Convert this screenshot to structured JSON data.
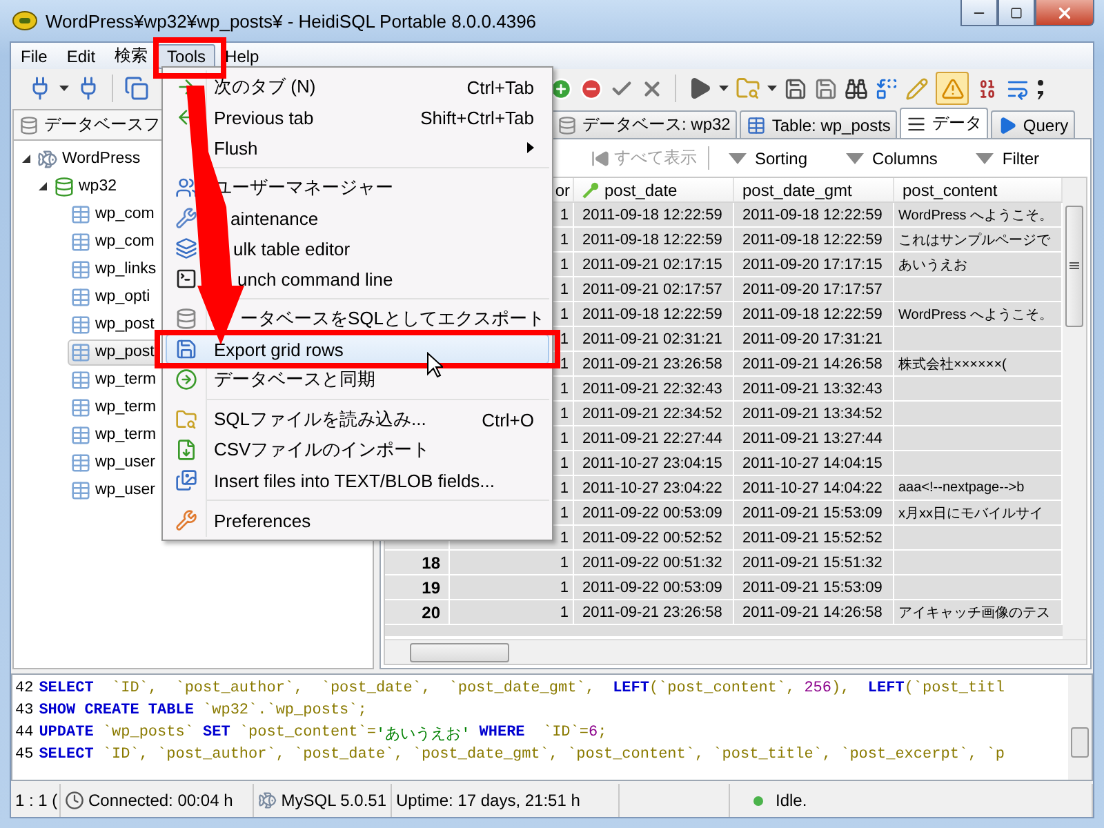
{
  "window": {
    "title": "WordPress¥wp32¥wp_posts¥ - HeidiSQL Portable 8.0.0.4396"
  },
  "menu_bar": [
    {
      "label": "File",
      "selected": false
    },
    {
      "label": "Edit",
      "selected": false
    },
    {
      "label": "検索",
      "selected": false
    },
    {
      "label": "Tools",
      "selected": true
    },
    {
      "label": "Help",
      "selected": false
    }
  ],
  "toolbar": {
    "toggle_button": {
      "on": true
    }
  },
  "tools_menu": [
    {
      "kind": "item",
      "label": "次のタブ (N)",
      "shortcut": "Ctrl+Tab",
      "selected": false
    },
    {
      "kind": "item",
      "label": "Previous tab",
      "shortcut": "Shift+Ctrl+Tab",
      "selected": false
    },
    {
      "kind": "submenu",
      "label": "Flush",
      "selected": false
    },
    {
      "kind": "separator"
    },
    {
      "kind": "item",
      "label": "ユーザーマネージャー",
      "selected": false
    },
    {
      "kind": "item",
      "label": "aintenance",
      "selected": false
    },
    {
      "kind": "item",
      "label": "ulk table editor",
      "selected": false
    },
    {
      "kind": "item",
      "label": "unch command line",
      "selected": false
    },
    {
      "kind": "separator"
    },
    {
      "kind": "item",
      "label": "ータベースをSQLとしてエクスポート",
      "selected": false
    },
    {
      "kind": "item",
      "label": "Export grid rows",
      "selected": true
    },
    {
      "kind": "item",
      "label": "データベースと同期",
      "selected": false
    },
    {
      "kind": "separator"
    },
    {
      "kind": "item",
      "label": "SQLファイルを読み込み...",
      "shortcut": "Ctrl+O",
      "selected": false
    },
    {
      "kind": "item",
      "label": "CSVファイルのインポート",
      "selected": false
    },
    {
      "kind": "item",
      "label": "Insert files into TEXT/BLOB fields...",
      "selected": false
    },
    {
      "kind": "separator"
    },
    {
      "kind": "item",
      "label": "Preferences",
      "selected": false
    }
  ],
  "left_panel": {
    "tab": "データベースフ",
    "tree": [
      {
        "label": "WordPress",
        "kind": "server",
        "expanded": true,
        "selected": false,
        "children": [
          {
            "label": "wp32",
            "kind": "database",
            "expanded": true,
            "selected": false,
            "children": [
              {
                "label": "wp_com",
                "kind": "table",
                "selected": false
              },
              {
                "label": "wp_com",
                "kind": "table",
                "selected": false
              },
              {
                "label": "wp_links",
                "kind": "table",
                "selected": false
              },
              {
                "label": "wp_opti",
                "kind": "table",
                "selected": false
              },
              {
                "label": "wp_post",
                "kind": "table",
                "selected": false
              },
              {
                "label": "wp_post",
                "kind": "table",
                "selected": true
              },
              {
                "label": "wp_term",
                "kind": "table",
                "selected": false
              },
              {
                "label": "wp_term",
                "kind": "table",
                "selected": false
              },
              {
                "label": "wp_term",
                "kind": "table",
                "selected": false
              },
              {
                "label": "wp_user",
                "kind": "table",
                "selected": false
              },
              {
                "label": "wp_user",
                "kind": "table",
                "selected": false
              }
            ]
          }
        ]
      }
    ]
  },
  "right_panel": {
    "tabs": [
      {
        "label": "データベース: wp32",
        "kind": "database",
        "selected": false
      },
      {
        "label": "Table: wp_posts",
        "kind": "table",
        "selected": false
      },
      {
        "label": "データ",
        "kind": "data",
        "selected": true
      },
      {
        "label": "Query",
        "kind": "query",
        "selected": false
      }
    ],
    "grid_toolbar": {
      "show_all": {
        "label": "すべて表示",
        "disabled": true
      },
      "dropdowns": [
        "Sorting",
        "Columns",
        "Filter"
      ]
    },
    "grid": {
      "columns": [
        "or",
        "post_date",
        "post_date_gmt",
        "post_content"
      ],
      "rows": [
        {
          "cells": [
            "1",
            "2011-09-18 12:22:59",
            "2011-09-18 12:22:59",
            "WordPress へようこそ。"
          ]
        },
        {
          "cells": [
            "1",
            "2011-09-18 12:22:59",
            "2011-09-18 12:22:59",
            "これはサンプルページで"
          ]
        },
        {
          "cells": [
            "1",
            "2011-09-21 02:17:15",
            "2011-09-20 17:17:15",
            "あいうえお"
          ]
        },
        {
          "cells": [
            "1",
            "2011-09-21 02:17:57",
            "2011-09-20 17:17:57"
          ]
        },
        {
          "cells": [
            "1",
            "2011-09-18 12:22:59",
            "2011-09-18 12:22:59",
            "WordPress へようこそ。"
          ]
        },
        {
          "cells": [
            "1",
            "2011-09-21 02:31:21",
            "2011-09-20 17:31:21"
          ]
        },
        {
          "cells": [
            "1",
            "2011-09-21 23:26:58",
            "2011-09-21 14:26:58",
            "株式会社××××××("
          ]
        },
        {
          "cells": [
            "1",
            "2011-09-21 22:32:43",
            "2011-09-21 13:32:43"
          ]
        },
        {
          "cells": [
            "1",
            "2011-09-21 22:34:52",
            "2011-09-21 13:34:52"
          ]
        },
        {
          "cells": [
            "1",
            "2011-09-21 22:27:44",
            "2011-09-21 13:27:44"
          ]
        },
        {
          "cells": [
            "1",
            "2011-10-27 23:04:15",
            "2011-10-27 14:04:15"
          ]
        },
        {
          "cells": [
            "1",
            "2011-10-27 23:04:22",
            "2011-10-27 14:04:22",
            "aaa<!--nextpage-->b"
          ]
        },
        {
          "cells": [
            "1",
            "2011-09-22 00:53:09",
            "2011-09-21 15:53:09",
            "x月xx日にモバイルサイ"
          ]
        },
        {
          "cells": [
            "1",
            "2011-09-22 00:52:52",
            "2011-09-21 15:52:52"
          ]
        },
        {
          "number": "18",
          "cells": [
            "1",
            "2011-09-22 00:51:32",
            "2011-09-21 15:51:32"
          ]
        },
        {
          "number": "19",
          "cells": [
            "1",
            "2011-09-22 00:53:09",
            "2011-09-21 15:53:09"
          ]
        },
        {
          "number": "20",
          "cells": [
            "1",
            "2011-09-21 23:26:58",
            "2011-09-21 14:26:58",
            "アイキャッチ画像のテス"
          ]
        }
      ]
    }
  },
  "sql_log": [
    {
      "number": "42",
      "segments": [
        {
          "kind": "keyword",
          "text": "SELECT"
        },
        {
          "kind": "identifier",
          "text": "  `ID`,  `post_author`,  `post_date`,  `post_date_gmt`,  "
        },
        {
          "kind": "keyword",
          "text": "LEFT"
        },
        {
          "kind": "identifier",
          "text": "(`post_content`, "
        },
        {
          "kind": "number",
          "text": "256"
        },
        {
          "kind": "identifier",
          "text": "),  "
        },
        {
          "kind": "keyword",
          "text": "LEFT"
        },
        {
          "kind": "identifier",
          "text": "(`post_titl"
        }
      ]
    },
    {
      "number": "43",
      "segments": [
        {
          "kind": "keyword",
          "text": "SHOW CREATE TABLE"
        },
        {
          "kind": "identifier",
          "text": " `wp32`.`wp_posts`;"
        }
      ]
    },
    {
      "number": "44",
      "segments": [
        {
          "kind": "keyword",
          "text": "UPDATE"
        },
        {
          "kind": "identifier",
          "text": " `wp_posts` "
        },
        {
          "kind": "keyword",
          "text": "SET"
        },
        {
          "kind": "identifier",
          "text": " `post_content`="
        },
        {
          "kind": "string",
          "text": "'あいうえお'"
        },
        {
          "kind": "keyword",
          "text": " WHERE"
        },
        {
          "kind": "identifier",
          "text": "  `ID`="
        },
        {
          "kind": "number",
          "text": "6"
        },
        {
          "kind": "identifier",
          "text": ";"
        }
      ]
    },
    {
      "number": "45",
      "segments": [
        {
          "kind": "keyword",
          "text": "SELECT"
        },
        {
          "kind": "identifier",
          "text": " `ID`, `post_author`, `post_date`, `post_date_gmt`, `post_content`, `post_title`, `post_excerpt`, `p"
        }
      ]
    }
  ],
  "status_bar": {
    "cursor": "1 : 1 (",
    "connection": "Connected: 00:04 h",
    "server": "MySQL 5.0.51",
    "uptime": "Uptime: 17 days, 21:51 h",
    "state": "Idle."
  }
}
